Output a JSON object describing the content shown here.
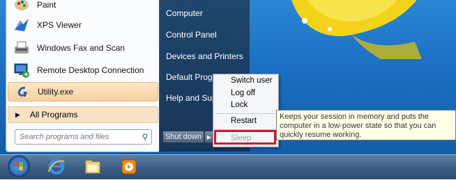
{
  "start_menu": {
    "programs": [
      {
        "label": "Paint",
        "icon": "paint-icon"
      },
      {
        "label": "XPS Viewer",
        "icon": "xps-viewer-icon"
      },
      {
        "label": "Windows Fax and Scan",
        "icon": "fax-scan-icon"
      },
      {
        "label": "Remote Desktop Connection",
        "icon": "remote-desktop-icon"
      },
      {
        "label": "Utility.exe",
        "icon": "utility-icon"
      }
    ],
    "all_programs": "All Programs",
    "search_placeholder": "Search programs and files",
    "right_items": [
      "Computer",
      "Control Panel",
      "Devices and Printers",
      "Default Program",
      "Help and Suppo"
    ],
    "shutdown_label": "Shut down"
  },
  "shutdown_submenu": {
    "items": [
      "Switch user",
      "Log off",
      "Lock",
      "Restart",
      "Sleep"
    ]
  },
  "tooltip": {
    "text": "Keeps your session in memory and puts the computer in a low-power state so that you can quickly resume working."
  },
  "taskbar": {
    "icons": [
      "start-orb-icon",
      "internet-explorer-icon",
      "windows-explorer-icon",
      "media-player-icon"
    ]
  },
  "colors": {
    "highlight_box": "#d0192f",
    "taskbar": "#3e5f86"
  }
}
